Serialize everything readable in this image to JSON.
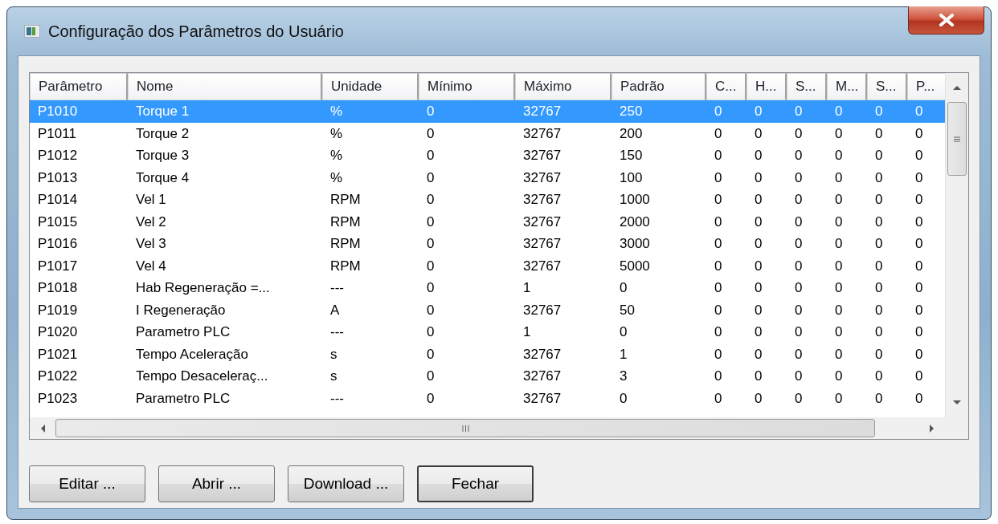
{
  "window": {
    "title": "Configuração dos Parâmetros do Usuário"
  },
  "table": {
    "columns": [
      "Parâmetro",
      "Nome",
      "Unidade",
      "Mínimo",
      "Máximo",
      "Padrão",
      "C...",
      "H...",
      "S...",
      "M...",
      "S...",
      "P..."
    ],
    "rows": [
      {
        "selected": true,
        "cells": [
          "P1010",
          "Torque 1",
          "%",
          "0",
          "32767",
          "250",
          "0",
          "0",
          "0",
          "0",
          "0",
          "0"
        ]
      },
      {
        "selected": false,
        "cells": [
          "P1011",
          "Torque 2",
          "%",
          "0",
          "32767",
          "200",
          "0",
          "0",
          "0",
          "0",
          "0",
          "0"
        ]
      },
      {
        "selected": false,
        "cells": [
          "P1012",
          "Torque 3",
          "%",
          "0",
          "32767",
          "150",
          "0",
          "0",
          "0",
          "0",
          "0",
          "0"
        ]
      },
      {
        "selected": false,
        "cells": [
          "P1013",
          "Torque 4",
          "%",
          "0",
          "32767",
          "100",
          "0",
          "0",
          "0",
          "0",
          "0",
          "0"
        ]
      },
      {
        "selected": false,
        "cells": [
          "P1014",
          "Vel 1",
          "RPM",
          "0",
          "32767",
          "1000",
          "0",
          "0",
          "0",
          "0",
          "0",
          "0"
        ]
      },
      {
        "selected": false,
        "cells": [
          "P1015",
          "Vel 2",
          "RPM",
          "0",
          "32767",
          "2000",
          "0",
          "0",
          "0",
          "0",
          "0",
          "0"
        ]
      },
      {
        "selected": false,
        "cells": [
          "P1016",
          "Vel 3",
          "RPM",
          "0",
          "32767",
          "3000",
          "0",
          "0",
          "0",
          "0",
          "0",
          "0"
        ]
      },
      {
        "selected": false,
        "cells": [
          "P1017",
          "Vel 4",
          "RPM",
          "0",
          "32767",
          "5000",
          "0",
          "0",
          "0",
          "0",
          "0",
          "0"
        ]
      },
      {
        "selected": false,
        "cells": [
          "P1018",
          "Hab Regeneração =...",
          "---",
          "0",
          "1",
          "0",
          "0",
          "0",
          "0",
          "0",
          "0",
          "0"
        ]
      },
      {
        "selected": false,
        "cells": [
          "P1019",
          "I Regeneração",
          "A",
          "0",
          "32767",
          "50",
          "0",
          "0",
          "0",
          "0",
          "0",
          "0"
        ]
      },
      {
        "selected": false,
        "cells": [
          "P1020",
          "Parametro PLC",
          "---",
          "0",
          "1",
          "0",
          "0",
          "0",
          "0",
          "0",
          "0",
          "0"
        ]
      },
      {
        "selected": false,
        "cells": [
          "P1021",
          "Tempo Aceleração",
          "s",
          "0",
          "32767",
          "1",
          "0",
          "0",
          "0",
          "0",
          "0",
          "0"
        ]
      },
      {
        "selected": false,
        "cells": [
          "P1022",
          "Tempo Desaceleraç...",
          "s",
          "0",
          "32767",
          "3",
          "0",
          "0",
          "0",
          "0",
          "0",
          "0"
        ]
      },
      {
        "selected": false,
        "cells": [
          "P1023",
          "Parametro PLC",
          "---",
          "0",
          "32767",
          "0",
          "0",
          "0",
          "0",
          "0",
          "0",
          "0"
        ]
      }
    ]
  },
  "buttons": [
    {
      "label": "Editar ...",
      "default": false
    },
    {
      "label": "Abrir ...",
      "default": false
    },
    {
      "label": "Download ...",
      "default": false
    },
    {
      "label": "Fechar",
      "default": true
    }
  ]
}
